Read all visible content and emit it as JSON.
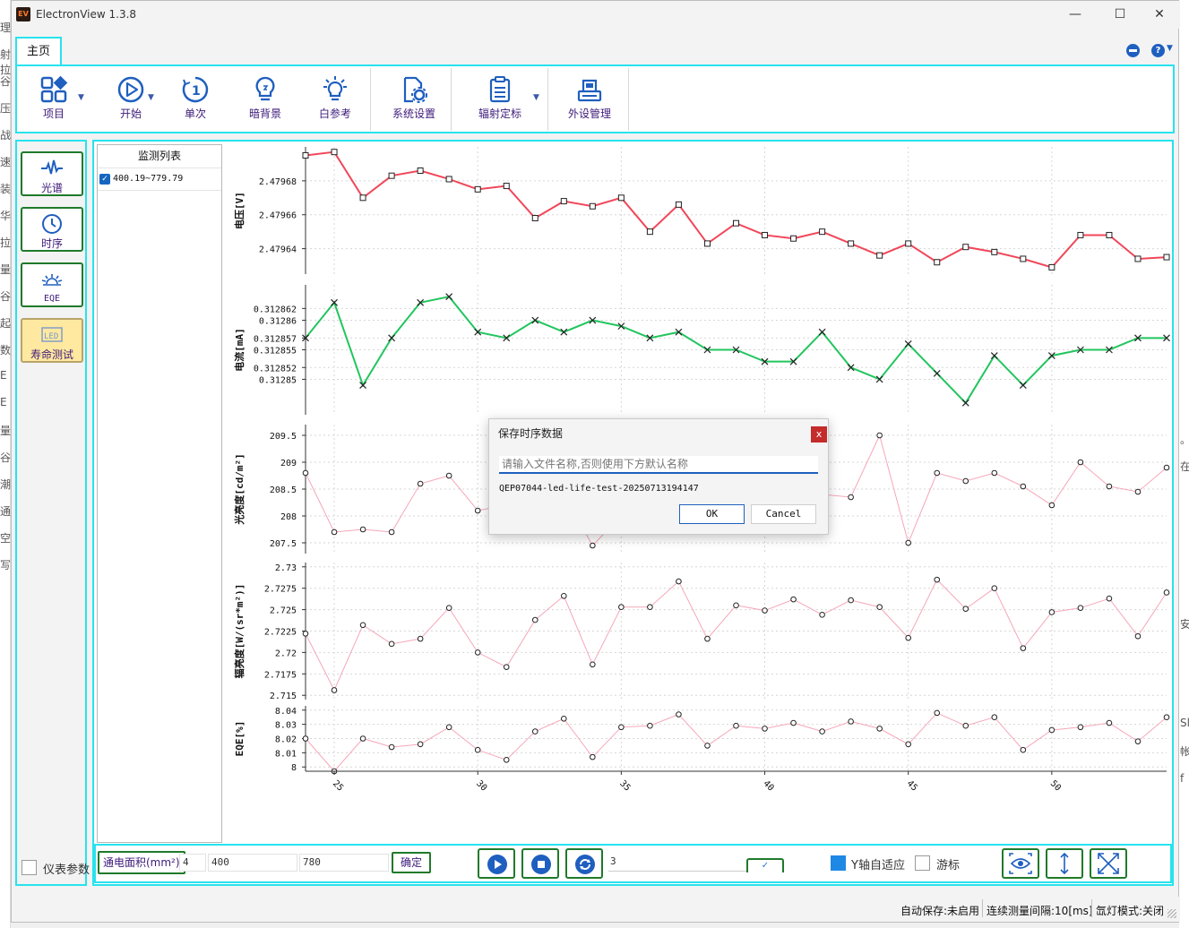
{
  "window": {
    "title": "ElectronView 1.3.8",
    "icon_text": "EV",
    "controls": {
      "minimize": "—",
      "maximize": "☐",
      "close": "✕"
    }
  },
  "tabs": [
    {
      "label": "主页"
    }
  ],
  "ribbon": {
    "buttons": [
      {
        "label": "项目",
        "icon": "grid-icon"
      },
      {
        "label": "开始",
        "icon": "play-icon"
      },
      {
        "label": "单次",
        "icon": "single-icon"
      },
      {
        "label": "暗背景",
        "icon": "bulb-icon"
      },
      {
        "label": "白参考",
        "icon": "bright-bulb-icon"
      },
      {
        "label": "系统设置",
        "icon": "settings-doc-icon"
      },
      {
        "label": "辐射定标",
        "icon": "clipboard-icon"
      },
      {
        "label": "外设管理",
        "icon": "device-icon"
      }
    ]
  },
  "sidebar": {
    "items": [
      {
        "label": "光谱",
        "icon": "waveform-icon"
      },
      {
        "label": "时序",
        "icon": "clock-icon"
      },
      {
        "label": "EQE",
        "icon": "rays-icon"
      },
      {
        "label": "寿命测试",
        "icon": "led-icon"
      }
    ],
    "meter_label": "仪表参数"
  },
  "monitor": {
    "title": "监测列表",
    "items": [
      {
        "label": "400.19~779.79",
        "checked": true
      }
    ]
  },
  "chart_data": [
    {
      "type": "line",
      "ylabel": "电压[V]",
      "color": "#f0475a",
      "marker": "square",
      "x": [
        24,
        25,
        26,
        27,
        28,
        29,
        30,
        31,
        32,
        33,
        34,
        35,
        36,
        37,
        38,
        39,
        40,
        41,
        42,
        43,
        44,
        45,
        46,
        47,
        48,
        49,
        50,
        51,
        52,
        53,
        54
      ],
      "values": [
        2.479695,
        2.479697,
        2.47967,
        2.479683,
        2.479686,
        2.479681,
        2.479675,
        2.479677,
        2.479658,
        2.479668,
        2.479665,
        2.47967,
        2.47965,
        2.479666,
        2.479643,
        2.479655,
        2.479648,
        2.479646,
        2.47965,
        2.479643,
        2.479636,
        2.479643,
        2.479632,
        2.479641,
        2.479638,
        2.479634,
        2.479629,
        2.479648,
        2.479648,
        2.479634,
        2.479635
      ],
      "ylim": [
        2.479625,
        2.4797
      ],
      "yticks": [
        "2.47968",
        "2.47966",
        "2.47964"
      ]
    },
    {
      "type": "line",
      "ylabel": "电流[mA]",
      "color": "#22c55e",
      "marker": "x",
      "x": [
        24,
        25,
        26,
        27,
        28,
        29,
        30,
        31,
        32,
        33,
        34,
        35,
        36,
        37,
        38,
        39,
        40,
        41,
        42,
        43,
        44,
        45,
        46,
        47,
        48,
        49,
        50,
        51,
        52,
        53,
        54
      ],
      "values": [
        0.312857,
        0.312863,
        0.312849,
        0.312857,
        0.312863,
        0.312864,
        0.312858,
        0.312857,
        0.31286,
        0.312858,
        0.31286,
        0.312859,
        0.312857,
        0.312858,
        0.312855,
        0.312855,
        0.312853,
        0.312853,
        0.312858,
        0.312852,
        0.31285,
        0.312856,
        0.312851,
        0.312846,
        0.312854,
        0.312849,
        0.312854,
        0.312855,
        0.312855,
        0.312857,
        0.312857
      ],
      "ylim": [
        0.312844,
        0.312866
      ],
      "yticks": [
        "0.312862",
        "0.31286",
        "0.312857",
        "0.312855",
        "0.312852",
        "0.31285"
      ]
    },
    {
      "type": "line",
      "ylabel": "光亮度[cd/m²]",
      "color": "#f5a7b8",
      "marker": "circle",
      "x": [
        24,
        25,
        26,
        27,
        28,
        29,
        30,
        31,
        32,
        33,
        34,
        35,
        36,
        37,
        38,
        39,
        40,
        41,
        42,
        43,
        44,
        45,
        46,
        47,
        48,
        49,
        50,
        51,
        52,
        53,
        54
      ],
      "values": [
        208.8,
        207.7,
        207.75,
        207.7,
        208.6,
        208.75,
        208.1,
        208.2,
        208.3,
        208.4,
        207.45,
        208.0,
        208.3,
        208.5,
        208.6,
        208.4,
        208.5,
        208.3,
        208.4,
        208.35,
        209.5,
        207.5,
        208.8,
        208.65,
        208.8,
        208.55,
        208.2,
        209.0,
        208.55,
        208.45,
        208.9
      ],
      "ylim": [
        207.3,
        209.7
      ],
      "yticks": [
        "209.5",
        "209",
        "208.5",
        "208",
        "207.5"
      ]
    },
    {
      "type": "line",
      "ylabel": "辐亮度[W/(sr*m²)]",
      "color": "#f5a7b8",
      "marker": "circle",
      "x": [
        24,
        25,
        26,
        27,
        28,
        29,
        30,
        31,
        32,
        33,
        34,
        35,
        36,
        37,
        38,
        39,
        40,
        41,
        42,
        43,
        44,
        45,
        46,
        47,
        48,
        49,
        50,
        51,
        52,
        53,
        54
      ],
      "values": [
        2.7222,
        2.7156,
        2.7232,
        2.721,
        2.7216,
        2.7252,
        2.72,
        2.7183,
        2.7238,
        2.7266,
        2.7186,
        2.7253,
        2.7253,
        2.7283,
        2.7216,
        2.7255,
        2.7249,
        2.7262,
        2.7244,
        2.7261,
        2.7253,
        2.7217,
        2.7285,
        2.7251,
        2.7275,
        2.7205,
        2.7247,
        2.7252,
        2.7263,
        2.7219,
        2.727
      ],
      "ylim": [
        2.7145,
        2.7305
      ],
      "yticks": [
        "2.73",
        "2.7275",
        "2.725",
        "2.7225",
        "2.72",
        "2.7175",
        "2.715"
      ]
    },
    {
      "type": "line",
      "ylabel": "EQE[%]",
      "color": "#f5a7b8",
      "marker": "circle",
      "x": [
        24,
        25,
        26,
        27,
        28,
        29,
        30,
        31,
        32,
        33,
        34,
        35,
        36,
        37,
        38,
        39,
        40,
        41,
        42,
        43,
        44,
        45,
        46,
        47,
        48,
        49,
        50,
        51,
        52,
        53,
        54
      ],
      "values": [
        8.02,
        7.997,
        8.02,
        8.014,
        8.016,
        8.028,
        8.012,
        8.005,
        8.025,
        8.034,
        8.007,
        8.028,
        8.029,
        8.037,
        8.015,
        8.029,
        8.027,
        8.031,
        8.025,
        8.032,
        8.027,
        8.016,
        8.038,
        8.029,
        8.035,
        8.012,
        8.026,
        8.028,
        8.031,
        8.018,
        8.035
      ],
      "ylim": [
        7.997,
        8.043
      ],
      "yticks": [
        "8.04",
        "8.03",
        "8.02",
        "8.01",
        "8"
      ]
    }
  ],
  "x_axis": {
    "ticks": [
      "25",
      "30",
      "35",
      "40",
      "45",
      "50"
    ],
    "xlim": [
      24,
      54
    ]
  },
  "controls": {
    "area_label": "通电面积(mm²)",
    "area_value": "4",
    "wl_start": "400",
    "wl_end": "780",
    "confirm_label": "确定",
    "interval_value": "3",
    "apply_label": "✓",
    "y_auto_label": "Y轴自适应",
    "cursor_label": "游标"
  },
  "status": {
    "autosave": "自动保存:未启用",
    "interval": "连续测量间隔:10[ms]",
    "lamp": "氙灯模式:关闭"
  },
  "dialog": {
    "title": "保存时序数据",
    "close": "x",
    "placeholder": "请输入文件名称,否则使用下方默认名称",
    "default_name": "QEP07044-led-life-test-20250713194147",
    "ok": "OK",
    "cancel": "Cancel"
  },
  "background_fragments": {
    "left": [
      "理",
      "射拉",
      "谷",
      "压",
      "战",
      "速",
      "装",
      "华",
      "拉",
      "量",
      "谷",
      "起",
      "数",
      "E",
      "E",
      "量",
      "谷",
      "潮",
      "通",
      "空",
      "写"
    ],
    "right": [
      "。",
      "在",
      "安",
      "Sl",
      "帐",
      "f"
    ]
  }
}
